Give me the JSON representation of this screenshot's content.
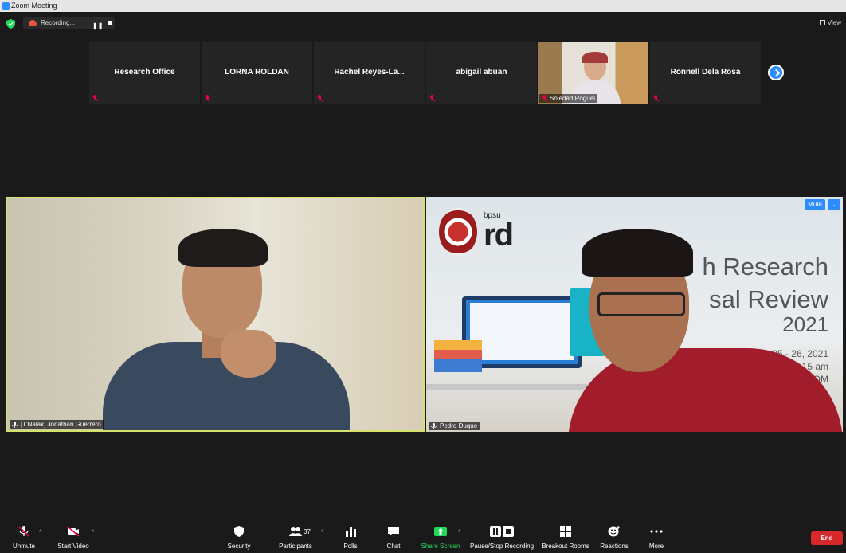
{
  "window": {
    "title": "Zoom Meeting"
  },
  "topbar": {
    "recording_label": "Recording...",
    "view_label": "View"
  },
  "strip": {
    "participants": [
      {
        "name": "Research Office"
      },
      {
        "name": "LORNA ROLDAN"
      },
      {
        "name": "Rachel  Reyes-La..."
      },
      {
        "name": "abigail abuan"
      },
      {
        "name": "Soledad Roguel"
      },
      {
        "name": "Ronnell Dela Rosa"
      }
    ]
  },
  "videos": {
    "left": {
      "name": "[T'Nalak] Jonathan Guerrero"
    },
    "right": {
      "name": "Pedro Duque",
      "mute_label": "Mute",
      "more_label": "...",
      "slide": {
        "logo_small": "bpsu",
        "logo_big": "rd",
        "line1": "h Research",
        "line2": "sal Review",
        "line3": "2021",
        "date": "August 25 - 26, 2021",
        "time": "8:15 am",
        "venue": "a ZOOM"
      }
    }
  },
  "toolbar": {
    "unmute": "Unmute",
    "start_video": "Start Video",
    "security": "Security",
    "participants": "Participants",
    "participants_count": "37",
    "polls": "Polls",
    "chat": "Chat",
    "share_screen": "Share Screen",
    "pause_recording": "Pause/Stop Recording",
    "breakout_rooms": "Breakout Rooms",
    "reactions": "Reactions",
    "more": "More",
    "end": "End"
  },
  "colors": {
    "accent": "#2d8cff",
    "share_green": "#23d959",
    "end_red": "#d9282c",
    "active_speaker": "#d5e36d"
  }
}
